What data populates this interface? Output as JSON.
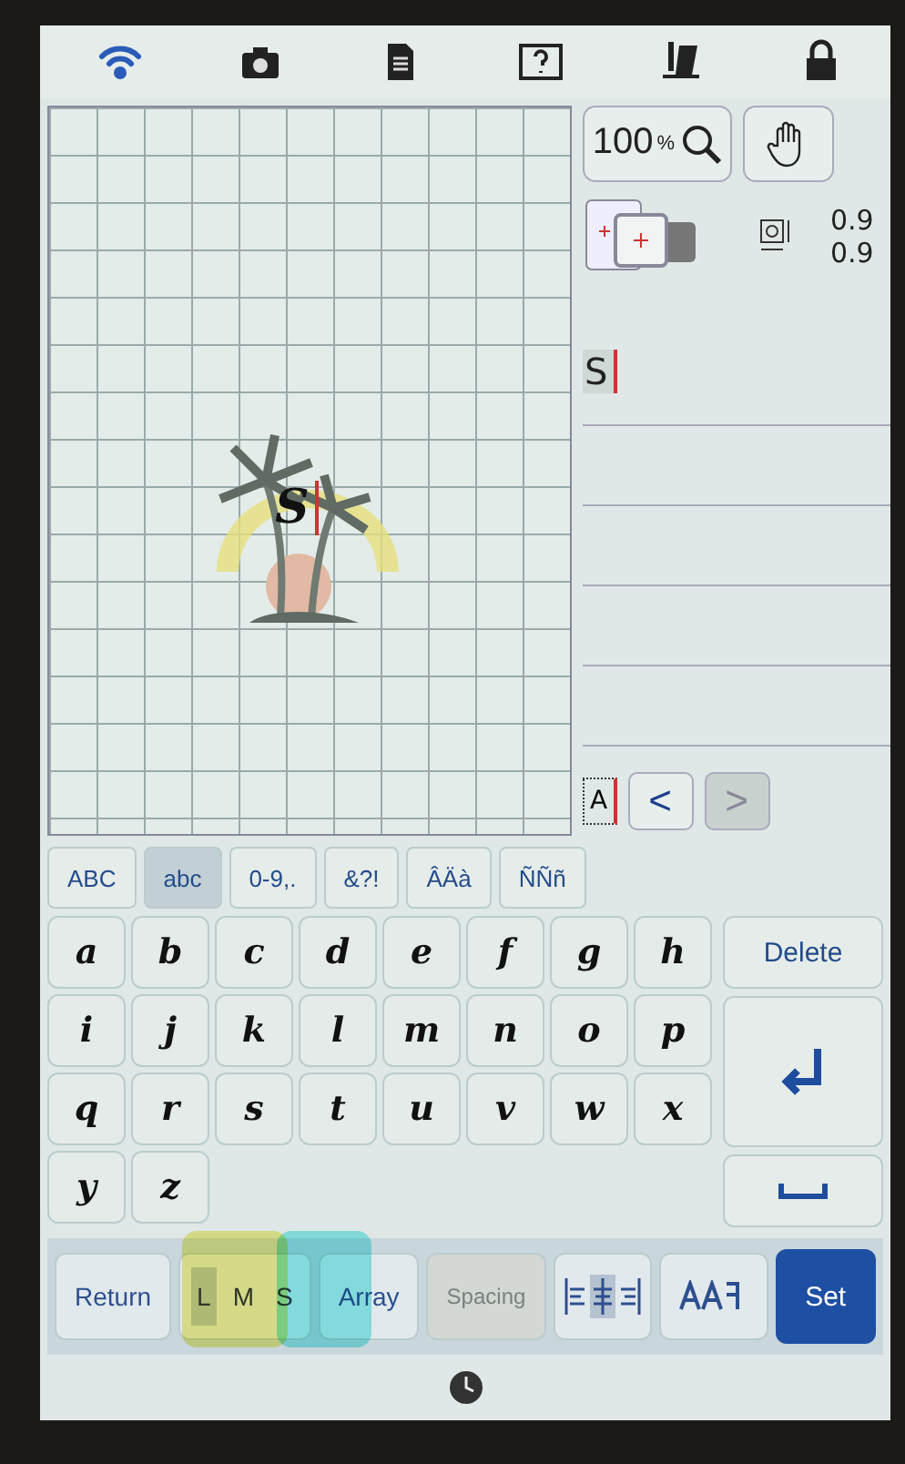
{
  "zoom_button": {
    "label": "100",
    "unit": "%"
  },
  "size_readings": [
    "0.9",
    "0.9"
  ],
  "text_lines": [
    {
      "value": "S"
    }
  ],
  "canvas_letter": "S",
  "cursor_char": "A",
  "nav": [
    {
      "symbol": "<",
      "disabled": false
    },
    {
      "symbol": ">",
      "disabled": true
    }
  ],
  "char_tabs": [
    {
      "label": "ABC",
      "selected": false
    },
    {
      "label": "abc",
      "selected": true
    },
    {
      "label": "0-9,.",
      "selected": false
    },
    {
      "label": "&?!",
      "selected": false
    },
    {
      "label": "ÂÄà",
      "selected": false
    },
    {
      "label": "ÑÑñ",
      "selected": false
    }
  ],
  "keys": [
    "a",
    "b",
    "c",
    "d",
    "e",
    "f",
    "g",
    "h",
    "i",
    "j",
    "k",
    "l",
    "m",
    "n",
    "o",
    "p",
    "q",
    "r",
    "s",
    "t",
    "u",
    "v",
    "w",
    "x",
    "y",
    "z"
  ],
  "delete_label": "Delete",
  "bottom": [
    {
      "kind": "text",
      "label": "Return",
      "disabled": false
    },
    {
      "kind": "size",
      "sizes": [
        {
          "label": "L",
          "selected": true
        },
        {
          "label": "M",
          "selected": false
        },
        {
          "label": "S",
          "selected": false
        }
      ]
    },
    {
      "kind": "text",
      "label": "Array",
      "disabled": false
    },
    {
      "kind": "text",
      "label": "Spacing",
      "disabled": true
    },
    {
      "kind": "align"
    },
    {
      "kind": "style"
    },
    {
      "kind": "set",
      "label": "Set"
    }
  ]
}
